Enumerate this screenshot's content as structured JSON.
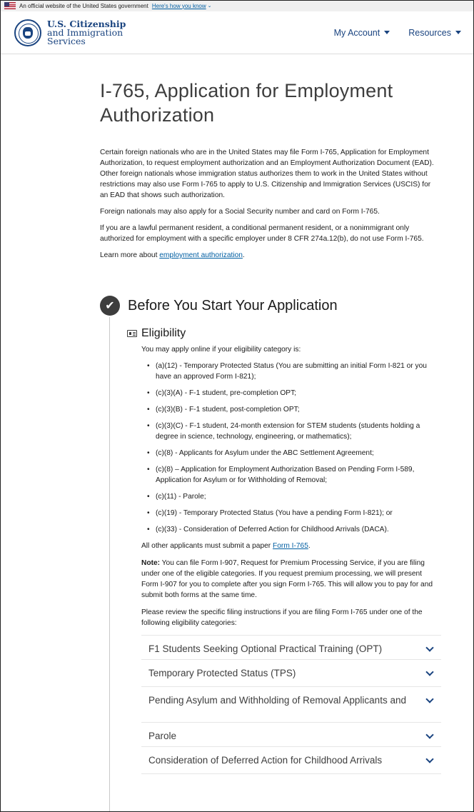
{
  "gov_banner": {
    "text": "An official website of the United States government",
    "link": "Here's how you know",
    "caret": "⌄"
  },
  "header": {
    "brand_line1": "U.S. Citizenship",
    "brand_line2": "and Immigration",
    "brand_line3": "Services",
    "nav": [
      {
        "label": "My Account"
      },
      {
        "label": "Resources"
      }
    ]
  },
  "main": {
    "title": "I-765, Application for Employment Authorization",
    "intro_p1": "Certain foreign nationals who are in the United States may file Form I-765, Application for Employment Authorization, to request employment authorization and an Employment Authorization Document (EAD). Other foreign nationals whose immigration status authorizes them to work in the United States without restrictions may also use Form I-765 to apply to U.S. Citizenship and Immigration Services (USCIS) for an EAD that shows such authorization.",
    "intro_p2": "Foreign nationals may also apply for a Social Security number and card on Form I-765.",
    "intro_p3": "If you are a lawful permanent resident, a conditional permanent resident, or a nonimmigrant only authorized for employment with a specific employer under 8 CFR 274a.12(b), do not use Form I-765.",
    "learn_more_prefix": "Learn more about ",
    "learn_more_link": "employment authorization",
    "learn_more_suffix": "."
  },
  "step": {
    "check": "✔",
    "title": "Before You Start Your Application"
  },
  "eligibility": {
    "title": "Eligibility",
    "lead": "You may apply online if your eligibility category is:",
    "items": [
      "(a)(12) - Temporary Protected Status (You are submitting an initial Form I-821 or you have an approved Form I-821);",
      "(c)(3)(A) - F-1 student, pre-completion OPT;",
      "(c)(3)(B) - F-1 student, post-completion OPT;",
      "(c)(3)(C) - F-1 student, 24-month extension for STEM students (students holding a degree in science, technology, engineering, or mathematics);",
      "(c)(8) - Applicants for Asylum under the ABC Settlement Agreement;",
      "(c)(8) – Application for Employment Authorization Based on Pending Form I-589, Application for Asylum or for Withholding of Removal;",
      "(c)(11) - Parole;",
      "(c)(19) - Temporary Protected Status (You have a pending Form I-821); or",
      "(c)(33) - Consideration of Deferred Action for Childhood Arrivals (DACA)."
    ],
    "paper_prefix": "All other applicants must submit a paper ",
    "paper_link": "Form I-765",
    "paper_suffix": ".",
    "note_label": "Note:",
    "note_text": " You can file Form I-907, Request for Premium Processing Service, if you are filing under one of the eligible categories. If you request premium processing, we will present Form I-907 for you to complete after you sign Form I-765. This will allow you to pay for and submit both forms at the same time.",
    "review_text": "Please review the specific filing instructions if you are filing Form I-765 under one of the following eligibility categories:"
  },
  "accordion": [
    {
      "label": "F1 Students Seeking Optional Practical Training (OPT)"
    },
    {
      "label": "Temporary Protected Status (TPS)"
    },
    {
      "label": "Pending Asylum and Withholding of Removal Applicants and"
    },
    {
      "label": "Parole"
    },
    {
      "label": "Consideration of Deferred Action for Childhood Arrivals"
    }
  ]
}
